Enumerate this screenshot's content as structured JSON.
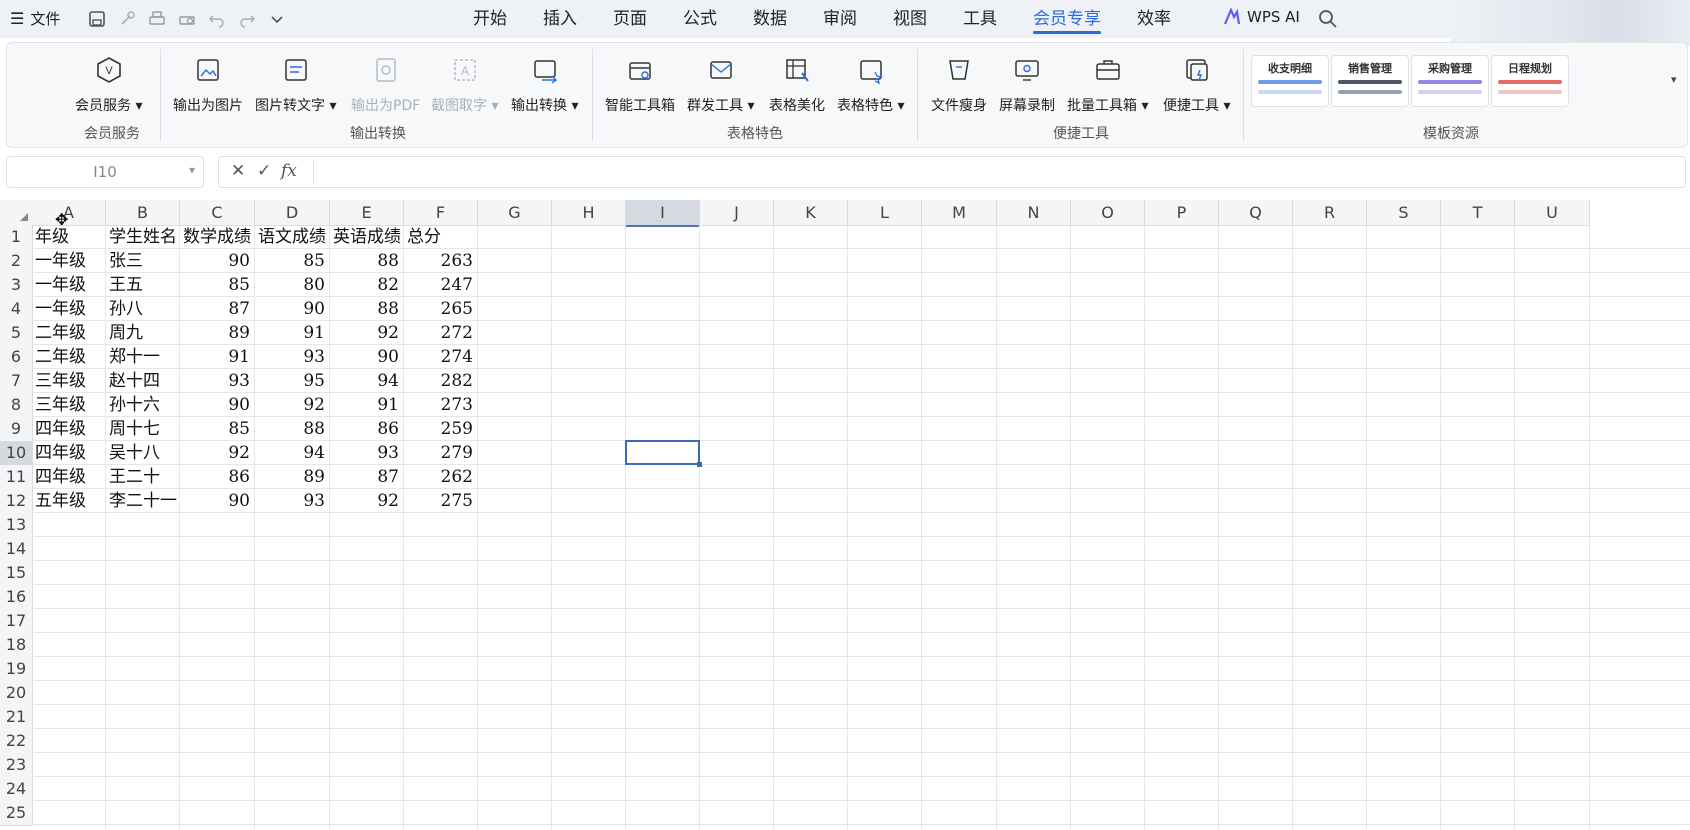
{
  "menubar": {
    "file_label": "文件",
    "tabs": [
      "开始",
      "插入",
      "页面",
      "公式",
      "数据",
      "审阅",
      "视图",
      "工具",
      "会员专享",
      "效率"
    ],
    "active_tab": "会员专享",
    "wps_ai_label": "WPS AI"
  },
  "ribbon": {
    "groups": [
      {
        "label": "会员服务",
        "buttons": [
          "会员服务"
        ]
      },
      {
        "label": "输出转换",
        "buttons": [
          "输出为图片",
          "图片转文字",
          "输出为PDF",
          "截图取字",
          "输出转换"
        ]
      },
      {
        "label": "表格特色",
        "buttons": [
          "智能工具箱",
          "群发工具",
          "表格美化",
          "表格特色"
        ]
      },
      {
        "label": "便捷工具",
        "buttons": [
          "文件瘦身",
          "屏幕录制",
          "批量工具箱",
          "便捷工具"
        ]
      },
      {
        "label": "模板资源",
        "templates": [
          "收支明细",
          "销售管理",
          "采购管理",
          "日程规划"
        ]
      }
    ],
    "disabled_buttons": [
      "输出为PDF",
      "截图取字"
    ]
  },
  "formula_bar": {
    "name_box": "I10",
    "fx_label": "fx",
    "cancel_icon": "close-icon",
    "confirm_icon": "check-icon",
    "formula": ""
  },
  "sheet": {
    "columns": [
      "A",
      "B",
      "C",
      "D",
      "E",
      "F",
      "G",
      "H",
      "I",
      "J",
      "K",
      "L",
      "M",
      "N",
      "O",
      "P",
      "Q",
      "R",
      "S",
      "T",
      "U"
    ],
    "rows": [
      "1",
      "2",
      "3",
      "4",
      "5",
      "6",
      "7",
      "8",
      "9",
      "10",
      "11",
      "12",
      "13",
      "14",
      "15",
      "16",
      "17",
      "18",
      "19",
      "20",
      "21",
      "22",
      "23",
      "24",
      "25"
    ],
    "selected_cell": "I10",
    "headers": [
      "年级",
      "学生姓名",
      "数学成绩",
      "语文成绩",
      "英语成绩",
      "总分"
    ],
    "data": [
      [
        "一年级",
        "张三",
        "90",
        "85",
        "88",
        "263"
      ],
      [
        "一年级",
        "王五",
        "85",
        "80",
        "82",
        "247"
      ],
      [
        "一年级",
        "孙八",
        "87",
        "90",
        "88",
        "265"
      ],
      [
        "二年级",
        "周九",
        "89",
        "91",
        "92",
        "272"
      ],
      [
        "二年级",
        "郑十一",
        "91",
        "93",
        "90",
        "274"
      ],
      [
        "三年级",
        "赵十四",
        "93",
        "95",
        "94",
        "282"
      ],
      [
        "三年级",
        "孙十六",
        "90",
        "92",
        "91",
        "273"
      ],
      [
        "四年级",
        "周十七",
        "85",
        "88",
        "86",
        "259"
      ],
      [
        "四年级",
        "吴十八",
        "92",
        "94",
        "93",
        "279"
      ],
      [
        "四年级",
        "王二十",
        "86",
        "89",
        "87",
        "262"
      ],
      [
        "五年级",
        "李二十一",
        "90",
        "93",
        "92",
        "275"
      ]
    ]
  },
  "colors": {
    "accent": "#2b6de0",
    "selection": "#3b6cb5",
    "header_bg": "#f4f5f7"
  }
}
